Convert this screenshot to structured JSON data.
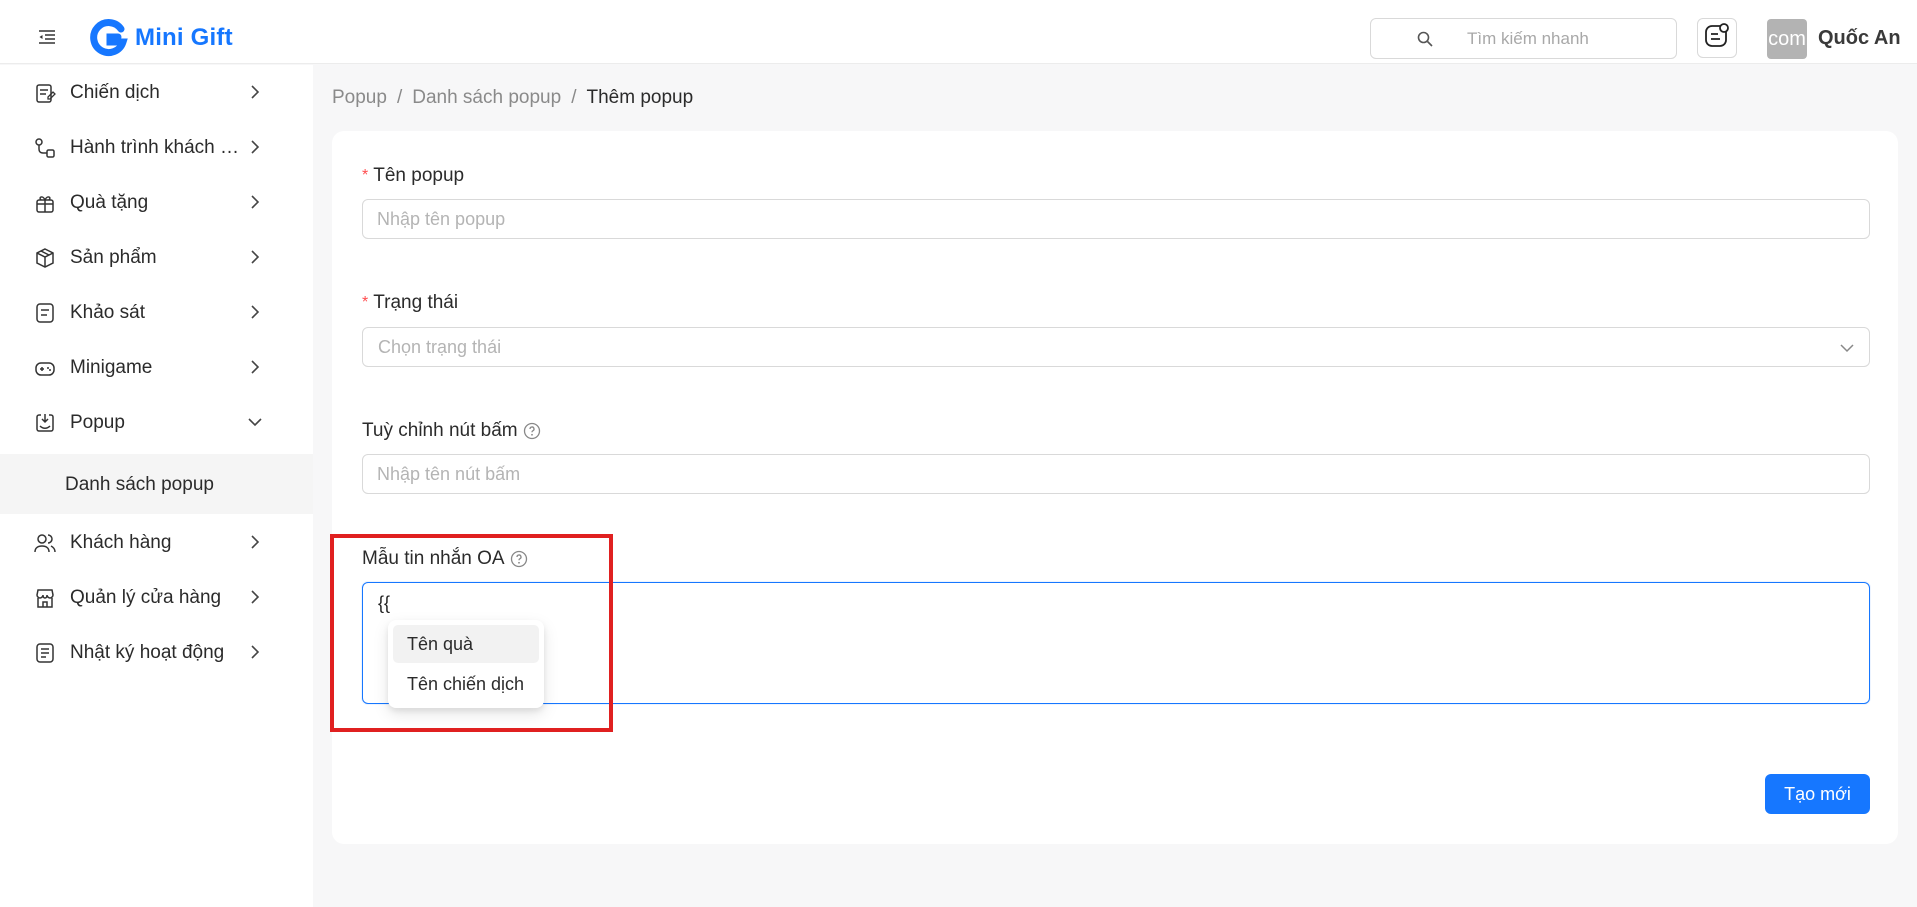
{
  "header": {
    "brand": "Mini Gift",
    "search_placeholder": "Tìm kiếm nhanh",
    "avatar_text": "com",
    "username": "Quốc An"
  },
  "sidebar": {
    "items": [
      {
        "label": "Chiến dịch",
        "icon": "campaign-icon"
      },
      {
        "label": "Hành trình khách hàng",
        "icon": "journey-icon"
      },
      {
        "label": "Quà tặng",
        "icon": "gift-icon"
      },
      {
        "label": "Sản phẩm",
        "icon": "box-icon"
      },
      {
        "label": "Khảo sát",
        "icon": "survey-icon"
      },
      {
        "label": "Minigame",
        "icon": "gamepad-icon"
      },
      {
        "label": "Popup",
        "icon": "popup-icon",
        "expanded": true
      },
      {
        "label": "Khách hàng",
        "icon": "users-icon"
      },
      {
        "label": "Quản lý cửa hàng",
        "icon": "store-icon"
      },
      {
        "label": "Nhật ký hoạt động",
        "icon": "log-icon"
      }
    ],
    "sub_items": [
      {
        "label": "Danh sách popup"
      }
    ]
  },
  "breadcrumb": {
    "items": [
      "Popup",
      "Danh sách popup",
      "Thêm popup"
    ],
    "separator": "/"
  },
  "form": {
    "name": {
      "label": "Tên popup",
      "placeholder": "Nhập tên popup",
      "required": true
    },
    "status": {
      "label": "Trạng thái",
      "placeholder": "Chọn trạng thái",
      "required": true
    },
    "button": {
      "label": "Tuỳ chỉnh nút bấm",
      "placeholder": "Nhập tên nút bấm"
    },
    "template": {
      "label": "Mẫu tin nhắn OA",
      "value": "{{"
    },
    "suggestions": [
      "Tên quà",
      "Tên chiến dịch"
    ],
    "submit_label": "Tạo mới"
  },
  "colors": {
    "primary": "#1677ff",
    "highlight": "#e02020",
    "required": "#ff4d4f"
  }
}
